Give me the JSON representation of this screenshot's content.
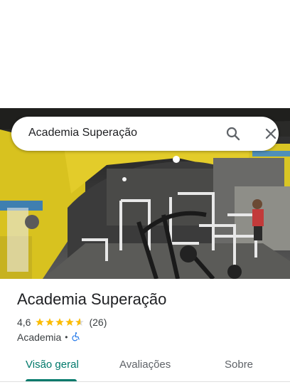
{
  "search": {
    "query": "Academia Superação"
  },
  "place": {
    "name": "Academia Superação",
    "rating": "4,6",
    "rating_value": 4.6,
    "review_count": "(26)",
    "category": "Academia",
    "separator": "•",
    "accessibility_icon": "wheelchair-accessible-icon"
  },
  "photo": {
    "subject": "gym-interior-photo"
  },
  "tabs": [
    {
      "label": "Visão geral",
      "active": true
    },
    {
      "label": "Avaliações",
      "active": false
    },
    {
      "label": "Sobre",
      "active": false
    }
  ],
  "colors": {
    "accent": "#00796b",
    "star": "#fbbc04",
    "accessibility": "#1a73e8",
    "text_primary": "#202124",
    "text_secondary": "#3c4043"
  }
}
